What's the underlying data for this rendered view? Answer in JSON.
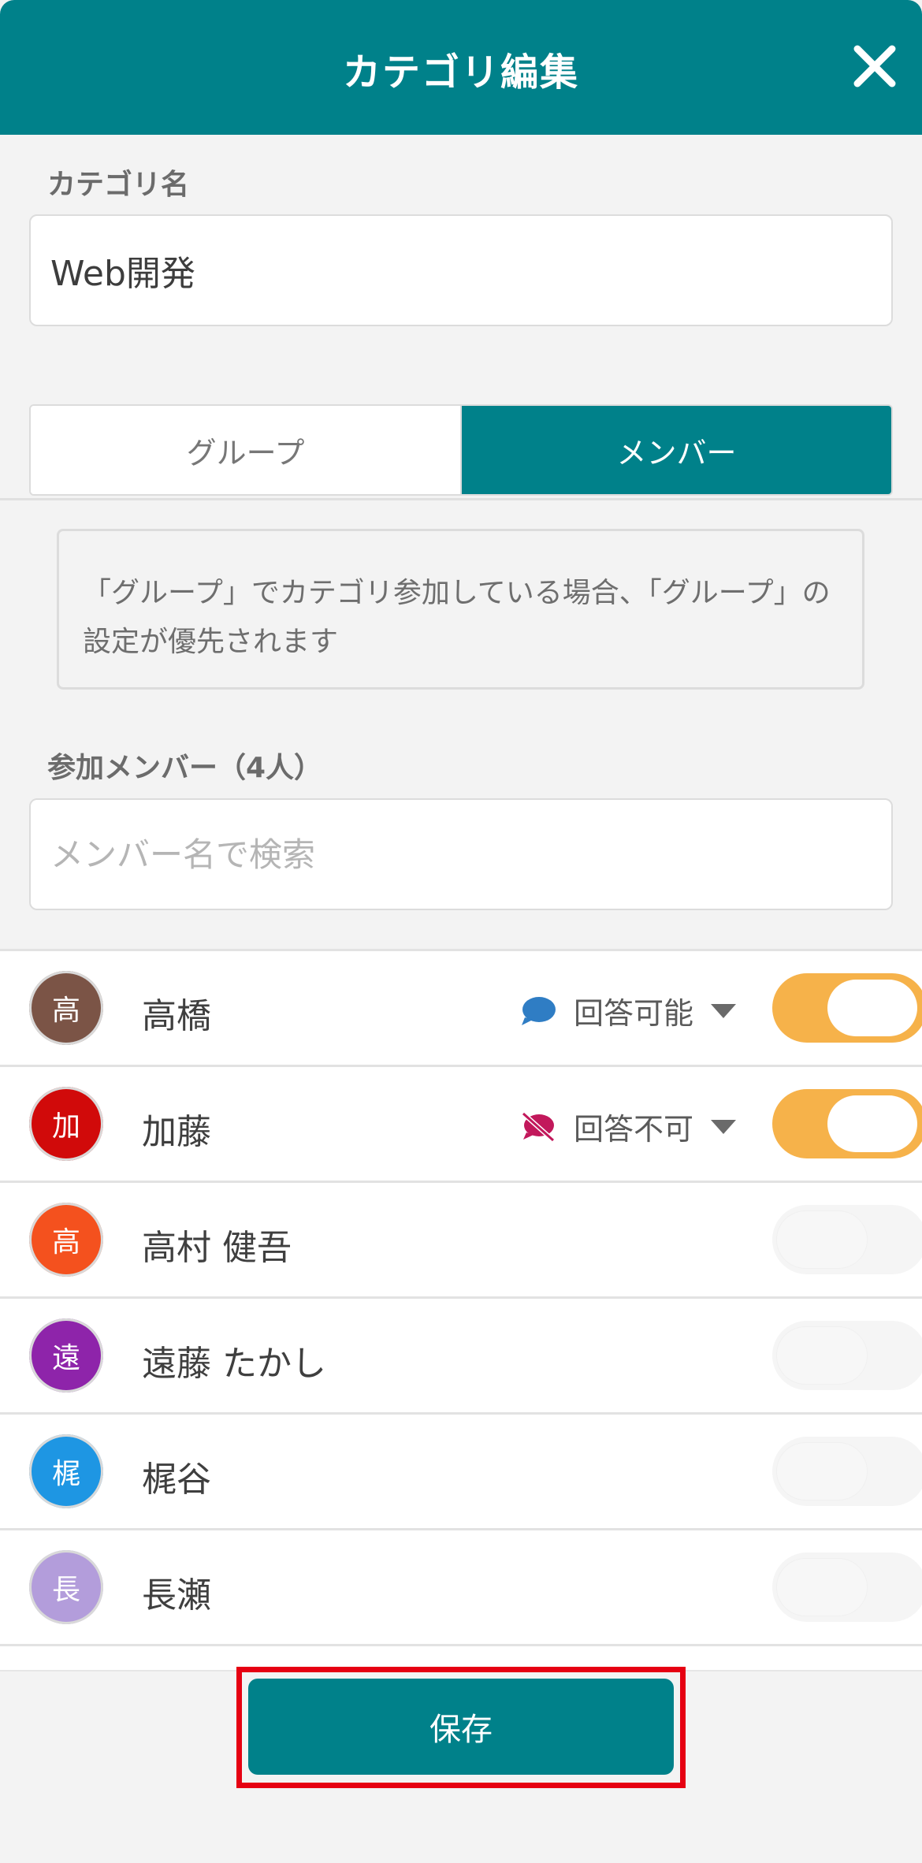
{
  "header": {
    "title": "カテゴリ編集"
  },
  "category": {
    "label": "カテゴリ名",
    "value": "Web開発"
  },
  "tabs": [
    {
      "label": "グループ"
    },
    {
      "label": "メンバー"
    }
  ],
  "notice": "「グループ」でカテゴリ参加している場合、「グループ」の設定が優先されます",
  "members_section": {
    "label": "参加メンバー（4人）",
    "search_placeholder": "メンバー名で検索"
  },
  "members": [
    {
      "avatar": "高",
      "avatar_color": "#7b5446",
      "name": "高橋",
      "permission": "回答可能",
      "permission_icon": "speech-bubble-icon",
      "enabled": true
    },
    {
      "avatar": "加",
      "avatar_color": "#d10a0a",
      "name": "加藤",
      "permission": "回答不可",
      "permission_icon": "speech-bubble-off-icon",
      "enabled": true
    },
    {
      "avatar": "高",
      "avatar_color": "#f4511e",
      "name": "高村 健吾",
      "enabled": false
    },
    {
      "avatar": "遠",
      "avatar_color": "#8e24aa",
      "name": "遠藤 たかし",
      "enabled": false
    },
    {
      "avatar": "梶",
      "avatar_color": "#1e96e3",
      "name": "梶谷",
      "enabled": false
    },
    {
      "avatar": "長",
      "avatar_color": "#b39ddb",
      "name": "長瀬",
      "enabled": false
    }
  ],
  "footer": {
    "save_label": "保存"
  },
  "colors": {
    "primary": "#00818a",
    "toggle_on": "#f6b24a",
    "highlight": "#e60012",
    "bubble_blue": "#2f7dc4",
    "bubble_off_red": "#c2185b"
  }
}
